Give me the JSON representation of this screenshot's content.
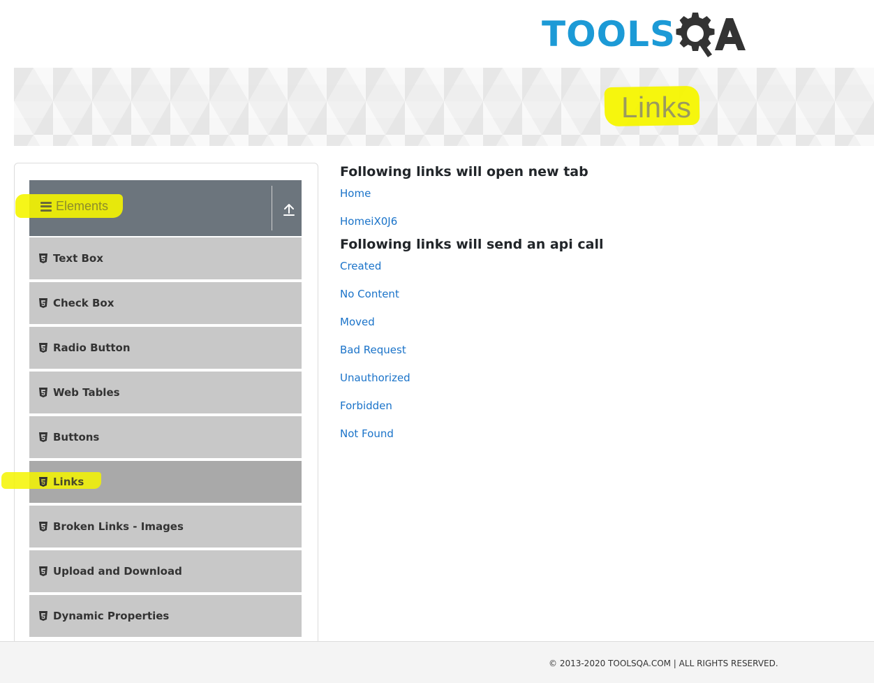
{
  "header": {
    "logo_text": "TOOLS",
    "logo_suffix": "QA",
    "logo_colors": {
      "tools": "#1c9ad6",
      "qa": "#333333"
    }
  },
  "banner": {
    "title": "Links"
  },
  "sidebar": {
    "group_title": "Elements",
    "items": [
      {
        "label": "Text Box",
        "icon": "html5-icon"
      },
      {
        "label": "Check Box",
        "icon": "html5-icon"
      },
      {
        "label": "Radio Button",
        "icon": "html5-icon"
      },
      {
        "label": "Web Tables",
        "icon": "html5-icon"
      },
      {
        "label": "Buttons",
        "icon": "html5-icon"
      },
      {
        "label": "Links",
        "icon": "html5-icon",
        "active": true
      },
      {
        "label": "Broken Links - Images",
        "icon": "html5-icon"
      },
      {
        "label": "Upload and Download",
        "icon": "html5-icon"
      },
      {
        "label": "Dynamic Properties",
        "icon": "html5-icon"
      }
    ]
  },
  "main": {
    "new_tab_title": "Following links will open new tab",
    "new_tab_links": [
      "Home",
      "HomeiX0J6"
    ],
    "api_title": "Following links will send an api call",
    "api_links": [
      "Created",
      "No Content",
      "Moved",
      "Bad Request",
      "Unauthorized",
      "Forbidden",
      "Not Found"
    ]
  },
  "footer": {
    "text": "© 2013-2020 TOOLSQA.COM | ALL RIGHTS RESERVED."
  },
  "colors": {
    "link": "#1a73c9",
    "menu_bg": "#c8c8c8",
    "menu_active_bg": "#a9a9a9",
    "group_header_bg": "#6c757d",
    "highlight": "#f5f500"
  }
}
